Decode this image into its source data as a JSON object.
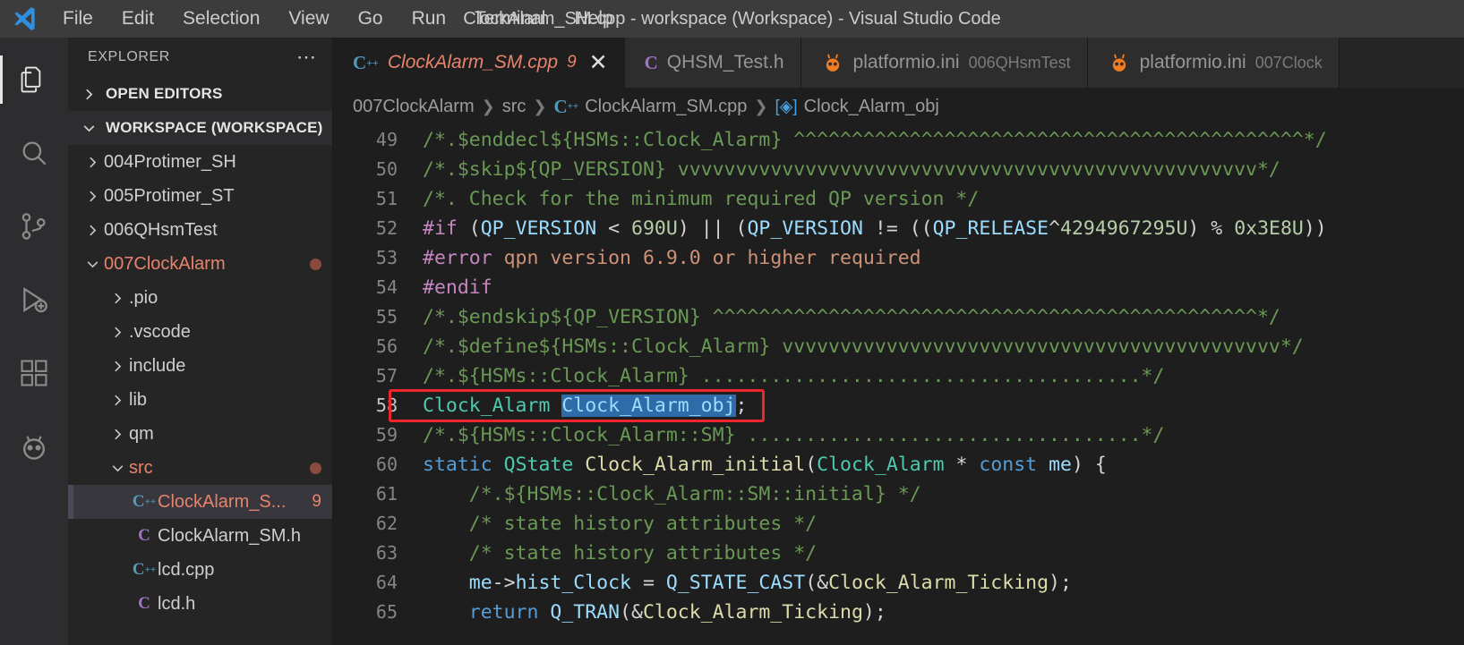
{
  "window": {
    "title": "ClockAlarm_SM.cpp - workspace (Workspace) - Visual Studio Code",
    "logo_icon": "vscode-logo"
  },
  "menubar": {
    "items": [
      {
        "label": "File"
      },
      {
        "label": "Edit"
      },
      {
        "label": "Selection"
      },
      {
        "label": "View"
      },
      {
        "label": "Go"
      },
      {
        "label": "Run"
      },
      {
        "label": "Terminal"
      },
      {
        "label": "Help"
      }
    ]
  },
  "activitybar": {
    "items": [
      {
        "icon": "files-explorer-icon",
        "active": true
      },
      {
        "icon": "search-icon",
        "active": false
      },
      {
        "icon": "source-control-icon",
        "active": false
      },
      {
        "icon": "run-and-debug-icon",
        "active": false
      },
      {
        "icon": "extensions-icon",
        "active": false
      },
      {
        "icon": "platformio-alien-icon",
        "active": false
      }
    ]
  },
  "sidebar": {
    "title": "EXPLORER",
    "more_actions_icon": "ellipsis-icon",
    "sections": [
      {
        "label": "OPEN EDITORS",
        "expanded": false
      },
      {
        "label": "WORKSPACE (WORKSPACE)",
        "expanded": true
      }
    ],
    "tree": [
      {
        "label": "004Protimer_SH",
        "type": "folder",
        "expanded": false,
        "indent": 1,
        "error": false,
        "badge": ""
      },
      {
        "label": "005Protimer_ST",
        "type": "folder",
        "expanded": false,
        "indent": 1,
        "error": false,
        "badge": ""
      },
      {
        "label": "006QHsmTest",
        "type": "folder",
        "expanded": false,
        "indent": 1,
        "error": false,
        "badge": ""
      },
      {
        "label": "007ClockAlarm",
        "type": "folder",
        "expanded": true,
        "indent": 1,
        "error": true,
        "badge": "dot"
      },
      {
        "label": ".pio",
        "type": "folder",
        "expanded": false,
        "indent": 2,
        "error": false,
        "badge": ""
      },
      {
        "label": ".vscode",
        "type": "folder",
        "expanded": false,
        "indent": 2,
        "error": false,
        "badge": ""
      },
      {
        "label": "include",
        "type": "folder",
        "expanded": false,
        "indent": 2,
        "error": false,
        "badge": ""
      },
      {
        "label": "lib",
        "type": "folder",
        "expanded": false,
        "indent": 2,
        "error": false,
        "badge": ""
      },
      {
        "label": "qm",
        "type": "folder",
        "expanded": false,
        "indent": 2,
        "error": false,
        "badge": ""
      },
      {
        "label": "src",
        "type": "folder",
        "expanded": true,
        "indent": 2,
        "error": true,
        "badge": "dot"
      },
      {
        "label": "ClockAlarm_S...",
        "type": "cpp",
        "indent": 3,
        "error": true,
        "badge": "9",
        "selected": true
      },
      {
        "label": "ClockAlarm_SM.h",
        "type": "h",
        "indent": 3,
        "error": false,
        "badge": ""
      },
      {
        "label": "lcd.cpp",
        "type": "cpp",
        "indent": 3,
        "error": false,
        "badge": ""
      },
      {
        "label": "lcd.h",
        "type": "h",
        "indent": 3,
        "error": false,
        "badge": ""
      }
    ]
  },
  "tabs": [
    {
      "name": "ClockAlarm_SM.cpp",
      "icon": "cpp-file-icon",
      "count": "9",
      "desc": "",
      "active": true,
      "closeable": true
    },
    {
      "name": "QHSM_Test.h",
      "icon": "c-header-file-icon",
      "count": "",
      "desc": "",
      "active": false,
      "closeable": false
    },
    {
      "name": "platformio.ini",
      "icon": "platformio-alien-icon",
      "count": "",
      "desc": "006QHsmTest",
      "active": false,
      "closeable": false
    },
    {
      "name": "platformio.ini",
      "icon": "platformio-alien-icon",
      "count": "",
      "desc": "007Clock",
      "active": false,
      "closeable": false
    }
  ],
  "breadcrumb": [
    {
      "label": "007ClockAlarm",
      "icon": ""
    },
    {
      "label": "src",
      "icon": ""
    },
    {
      "label": "ClockAlarm_SM.cpp",
      "icon": "cpp-file-icon"
    },
    {
      "label": "Clock_Alarm_obj",
      "icon": "symbol-variable-icon"
    }
  ],
  "close_tab_icon": "close-icon",
  "annotation": {
    "color": "#f0262c",
    "target_line": 58
  },
  "editor": {
    "first_line": 49,
    "current_line": 58,
    "selection_text": "Clock_Alarm_obj",
    "lines": [
      {
        "n": 49,
        "raw": "/*.$enddecl${HSMs::Clock_Alarm} ^^^^^^^^^^^^^^^^^^^^^^^^^^^^^^^^^^^^^^^^^^^^*/"
      },
      {
        "n": 50,
        "raw": "/*.$skip${QP_VERSION} vvvvvvvvvvvvvvvvvvvvvvvvvvvvvvvvvvvvvvvvvvvvvvvvvv*/"
      },
      {
        "n": 51,
        "raw": "/*. Check for the minimum required QP version */"
      },
      {
        "n": 52,
        "raw": "#if (QP_VERSION < 690U) || (QP_VERSION != ((QP_RELEASE^4294967295U) % 0x3E8U))"
      },
      {
        "n": 53,
        "raw": "#error qpn version 6.9.0 or higher required"
      },
      {
        "n": 54,
        "raw": "#endif"
      },
      {
        "n": 55,
        "raw": "/*.$endskip${QP_VERSION} ^^^^^^^^^^^^^^^^^^^^^^^^^^^^^^^^^^^^^^^^^^^^^^^*/"
      },
      {
        "n": 56,
        "raw": "/*.$define${HSMs::Clock_Alarm} vvvvvvvvvvvvvvvvvvvvvvvvvvvvvvvvvvvvvvvvvvv*/"
      },
      {
        "n": 57,
        "raw": "/*.${HSMs::Clock_Alarm} ......................................*/"
      },
      {
        "n": 58,
        "raw": "Clock_Alarm Clock_Alarm_obj;"
      },
      {
        "n": 59,
        "raw": "/*.${HSMs::Clock_Alarm::SM} ..................................*/"
      },
      {
        "n": 60,
        "raw": "static QState Clock_Alarm_initial(Clock_Alarm * const me) {"
      },
      {
        "n": 61,
        "raw": "    /*.${HSMs::Clock_Alarm::SM::initial} */"
      },
      {
        "n": 62,
        "raw": "    /* state history attributes */"
      },
      {
        "n": 63,
        "raw": "    /* state history attributes */"
      },
      {
        "n": 64,
        "raw": "    me->hist_Clock = Q_STATE_CAST(&Clock_Alarm_Ticking);"
      },
      {
        "n": 65,
        "raw": "    return Q_TRAN(&Clock_Alarm_Ticking);"
      }
    ]
  },
  "colors": {
    "titlebar_bg": "#3c3c3c",
    "sidebar_bg": "#252526",
    "editor_bg": "#1e1e1e",
    "activitybar_bg": "#2d2d30",
    "error_text": "#e8836b",
    "comment": "#6a9955",
    "keyword": "#569cd6",
    "preprocessor": "#c586c0",
    "number": "#b5cea8",
    "type": "#4ec9b0",
    "function": "#dcdcaa",
    "variable": "#9cdcfe",
    "string": "#ce9178",
    "selection": "#2f6ba8",
    "annotation": "#f0262c"
  }
}
